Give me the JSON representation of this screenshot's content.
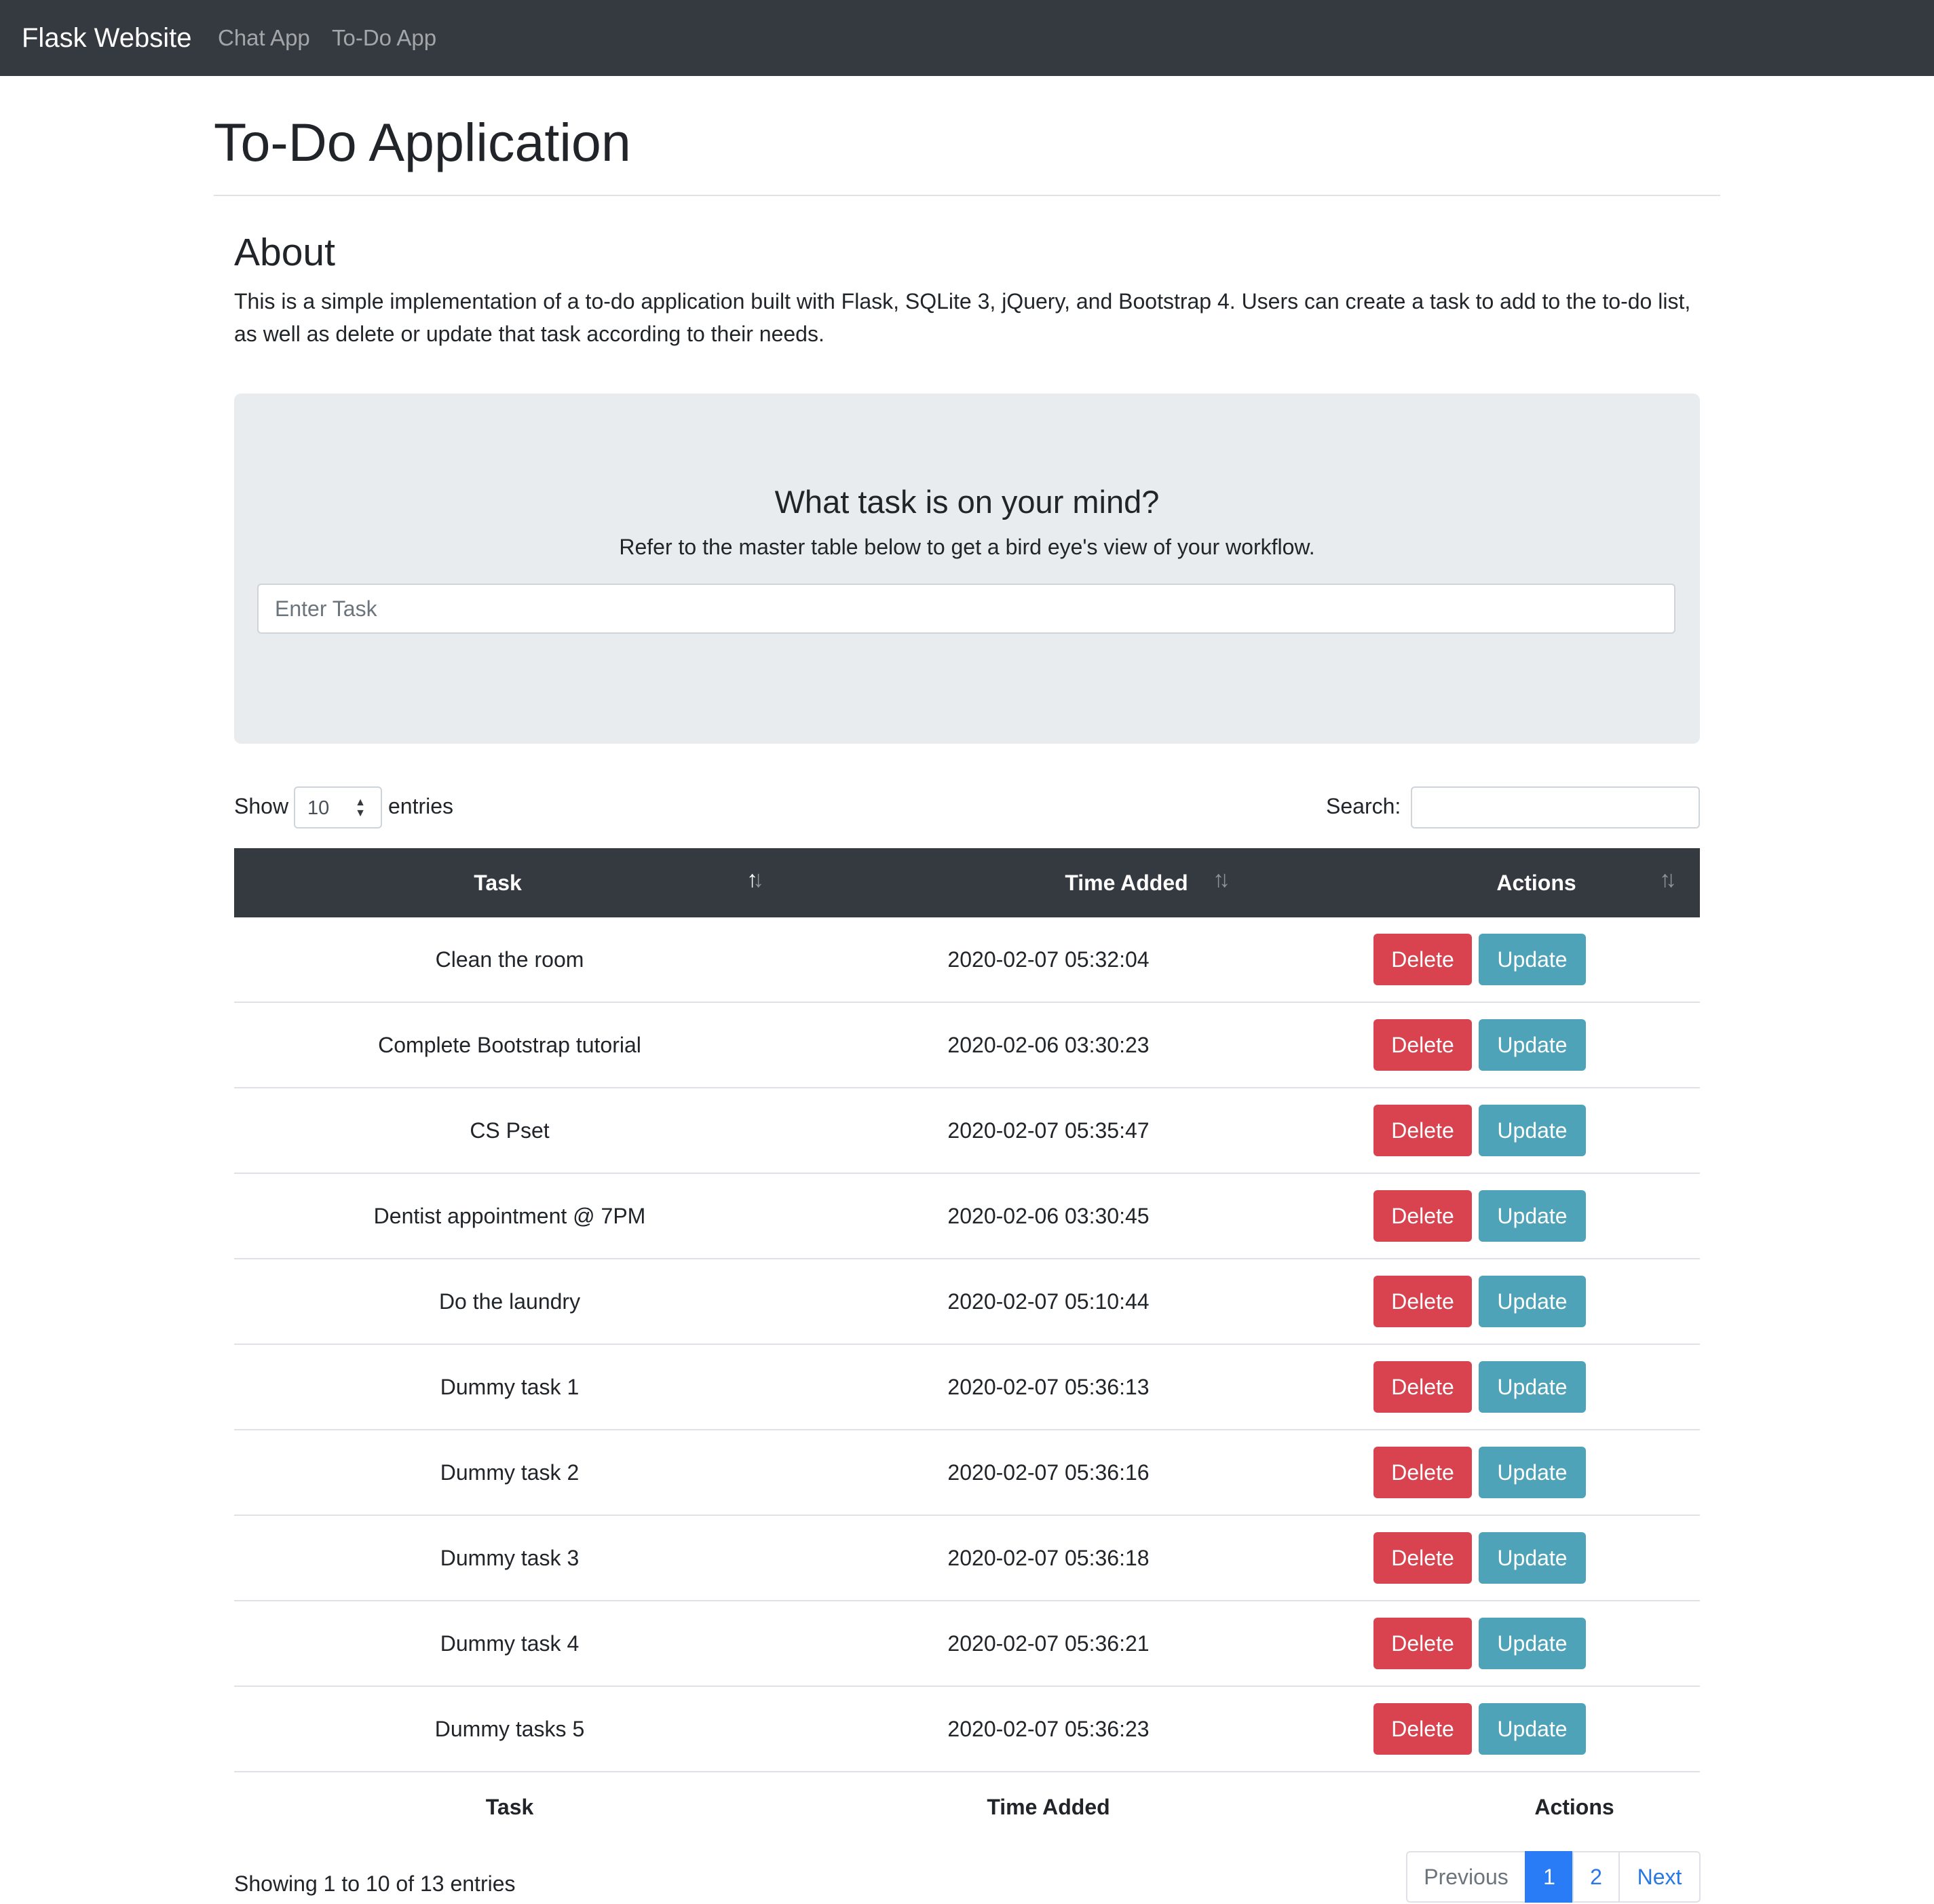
{
  "navbar": {
    "brand": "Flask Website",
    "links": [
      "Chat App",
      "To-Do App"
    ]
  },
  "page": {
    "title": "To-Do Application"
  },
  "about": {
    "title": "About",
    "text": "This is a simple implementation of a to-do application built with Flask, SQLite 3, jQuery, and Bootstrap 4. Users can create a task to add to the to-do list, as well as delete or update that task according to their needs."
  },
  "jumbotron": {
    "title": "What task is on your mind?",
    "subtitle": "Refer to the master table below to get a bird eye's view of your workflow.",
    "input_placeholder": "Enter Task",
    "input_value": ""
  },
  "table_controls": {
    "show_label": "Show",
    "length_value": "10",
    "entries_label": "entries",
    "search_label": "Search:",
    "search_value": ""
  },
  "table": {
    "columns": [
      "Task",
      "Time Added",
      "Actions"
    ],
    "delete_label": "Delete",
    "update_label": "Update",
    "rows": [
      {
        "task": "Clean the room",
        "time": "2020-02-07 05:32:04"
      },
      {
        "task": "Complete Bootstrap tutorial",
        "time": "2020-02-06 03:30:23"
      },
      {
        "task": "CS Pset",
        "time": "2020-02-07 05:35:47"
      },
      {
        "task": "Dentist appointment @ 7PM",
        "time": "2020-02-06 03:30:45"
      },
      {
        "task": "Do the laundry",
        "time": "2020-02-07 05:10:44"
      },
      {
        "task": "Dummy task 1",
        "time": "2020-02-07 05:36:13"
      },
      {
        "task": "Dummy task 2",
        "time": "2020-02-07 05:36:16"
      },
      {
        "task": "Dummy task 3",
        "time": "2020-02-07 05:36:18"
      },
      {
        "task": "Dummy task 4",
        "time": "2020-02-07 05:36:21"
      },
      {
        "task": "Dummy tasks 5",
        "time": "2020-02-07 05:36:23"
      }
    ],
    "sorted_column": "Task",
    "sort_direction": "ascending"
  },
  "footer": {
    "info": "Showing 1 to 10 of 13 entries",
    "pagination": {
      "previous": "Previous",
      "pages": [
        "1",
        "2"
      ],
      "current_page": "1",
      "next": "Next"
    }
  },
  "colors": {
    "navbar_bg": "#343a40",
    "delete_button": "#d9434f",
    "update_button": "#4ea3b8",
    "active_page": "#2a7cf6",
    "jumbotron_bg": "#e9ecef"
  },
  "icons": {
    "sort": "sort-arrows-icon",
    "select_arrows": "select-updown-icon"
  }
}
